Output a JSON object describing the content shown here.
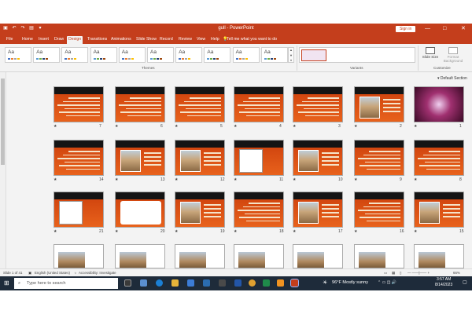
{
  "titlebar": {
    "title": "gull - PowerPoint",
    "signin": "Sign in",
    "minimize": "—",
    "restore": "□",
    "close": "✕"
  },
  "tabs": {
    "items": [
      "File",
      "Home",
      "Insert",
      "Draw",
      "Design",
      "Transitions",
      "Animations",
      "Slide Show",
      "Record",
      "Review",
      "View",
      "Help"
    ],
    "active": "Design",
    "tell": "Tell me what you want to do"
  },
  "ribbon": {
    "theme_label": "Aa",
    "groups": {
      "themes": "Themes",
      "variants": "Variants",
      "customize": "Customize"
    },
    "customize": {
      "slide_size": "Slide Size",
      "format_background": "Format Background"
    },
    "theme_colors": [
      [
        "#4472c4",
        "#ed7d31",
        "#a5a5a5",
        "#ffc000"
      ],
      [
        "#5b9bd5",
        "#70ad47",
        "#264478",
        "#9e480e"
      ],
      [
        "#4472c4",
        "#ed7d31",
        "#a5a5a5",
        "#ffc000"
      ],
      [
        "#5b9bd5",
        "#70ad47",
        "#264478",
        "#9e480e"
      ],
      [
        "#4472c4",
        "#ed7d31",
        "#a5a5a5",
        "#ffc000"
      ],
      [
        "#5b9bd5",
        "#70ad47",
        "#264478",
        "#9e480e"
      ],
      [
        "#4472c4",
        "#ed7d31",
        "#a5a5a5",
        "#ffc000"
      ],
      [
        "#5b9bd5",
        "#70ad47",
        "#264478",
        "#9e480e"
      ],
      [
        "#4472c4",
        "#ed7d31",
        "#a5a5a5",
        "#ffc000"
      ],
      [
        "#5b9bd5",
        "#70ad47",
        "#264478",
        "#9e480e"
      ]
    ]
  },
  "sorter": {
    "section": "Default Section",
    "slides": [
      {
        "n": "7",
        "kind": "text"
      },
      {
        "n": "6",
        "kind": "text"
      },
      {
        "n": "5",
        "kind": "text"
      },
      {
        "n": "4",
        "kind": "text"
      },
      {
        "n": "3",
        "kind": "text"
      },
      {
        "n": "2",
        "kind": "photo"
      },
      {
        "n": "1",
        "kind": "title"
      },
      {
        "n": "14",
        "kind": "text"
      },
      {
        "n": "13",
        "kind": "photo"
      },
      {
        "n": "12",
        "kind": "photo"
      },
      {
        "n": "11",
        "kind": "diagram"
      },
      {
        "n": "10",
        "kind": "photo"
      },
      {
        "n": "9",
        "kind": "text"
      },
      {
        "n": "8",
        "kind": "text"
      },
      {
        "n": "21",
        "kind": "diagram"
      },
      {
        "n": "20",
        "kind": "blank"
      },
      {
        "n": "19",
        "kind": "photo"
      },
      {
        "n": "18",
        "kind": "text"
      },
      {
        "n": "17",
        "kind": "photo"
      },
      {
        "n": "16",
        "kind": "text"
      },
      {
        "n": "15",
        "kind": "photo"
      },
      {
        "n": "",
        "kind": "white"
      },
      {
        "n": "",
        "kind": "white"
      },
      {
        "n": "",
        "kind": "white"
      },
      {
        "n": "",
        "kind": "white"
      },
      {
        "n": "",
        "kind": "white"
      },
      {
        "n": "",
        "kind": "white"
      },
      {
        "n": "",
        "kind": "white"
      }
    ]
  },
  "status": {
    "slide": "Slide 1 of 41",
    "language": "English (United States)",
    "accessibility": "Accessibility: Investigate",
    "zoom": "66%"
  },
  "taskbar": {
    "search": "Type here to search",
    "weather": "96°F  Mostly sunny",
    "time": "3:57 AM",
    "date": "8/14/2023"
  },
  "colors": {
    "accent": "#c43e1c",
    "taskbar": "#1e2b3a"
  }
}
